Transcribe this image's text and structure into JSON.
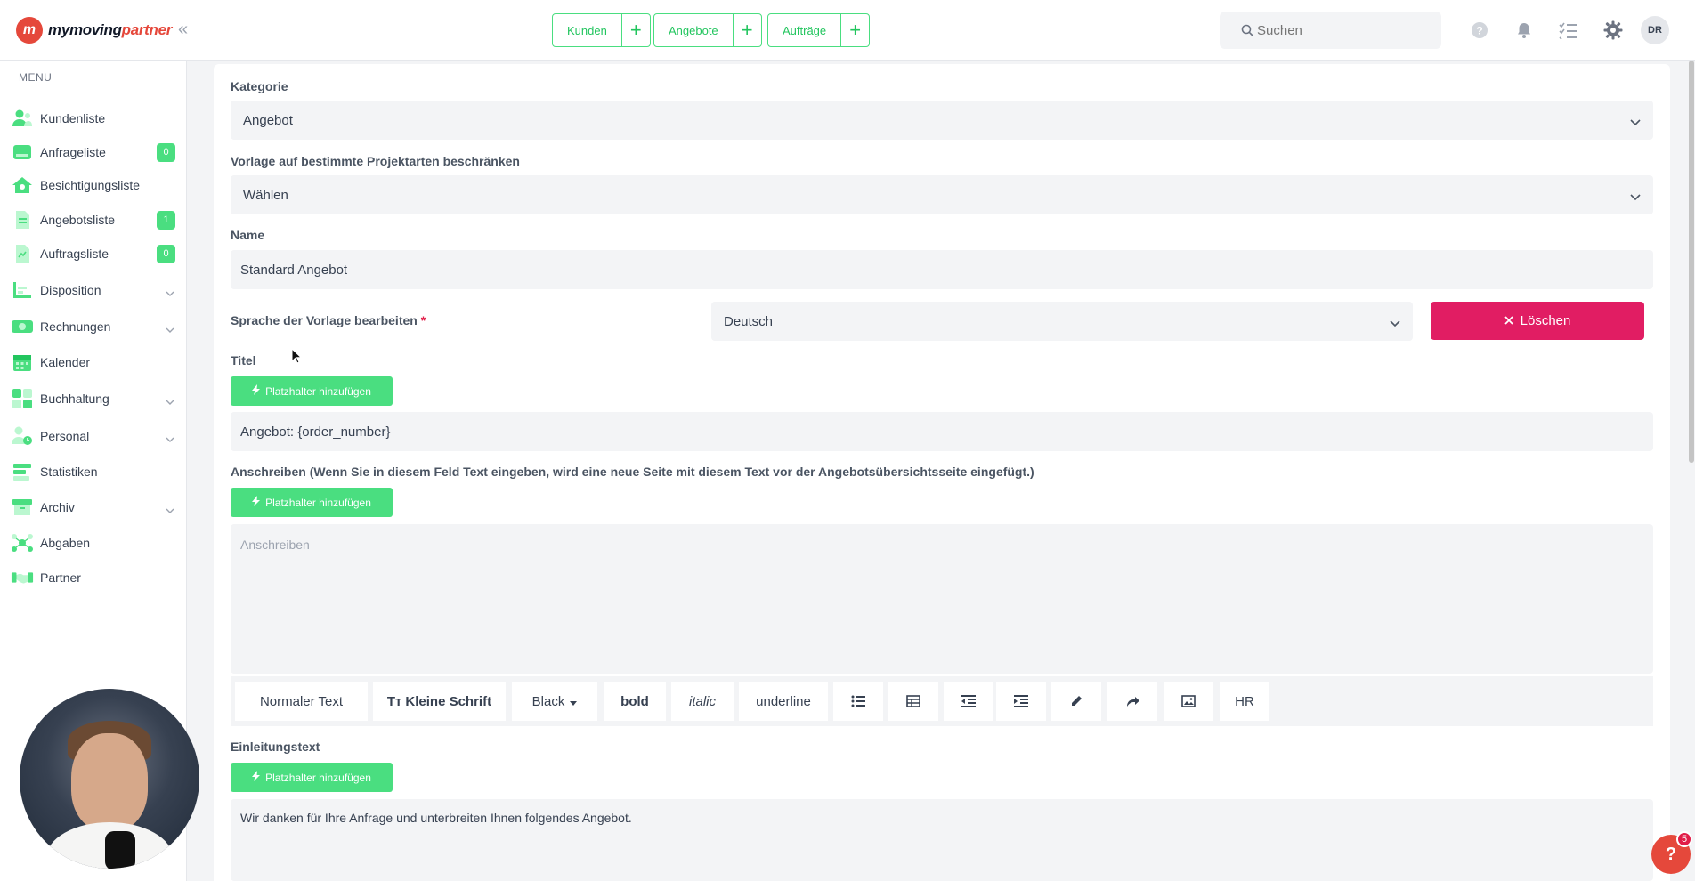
{
  "brand": {
    "name_part1": "mymoving",
    "name_part2": "partner"
  },
  "topbar": {
    "quick_actions": [
      {
        "label": "Kunden",
        "add": "+"
      },
      {
        "label": "Angebote",
        "add": "+"
      },
      {
        "label": "Aufträge",
        "add": "+"
      }
    ],
    "search_placeholder": "Suchen",
    "avatar_initials": "DR",
    "icons": [
      "question-icon",
      "bell-icon",
      "checklist-icon",
      "gear-icon"
    ]
  },
  "sidebar": {
    "menu_label": "MENU",
    "items": [
      {
        "label": "Kundenliste",
        "icon": "customers-icon"
      },
      {
        "label": "Anfrageliste",
        "icon": "inquiry-icon",
        "badge": "0"
      },
      {
        "label": "Besichtigungsliste",
        "icon": "inspection-icon"
      },
      {
        "label": "Angebotsliste",
        "icon": "offer-icon",
        "badge": "1"
      },
      {
        "label": "Auftragsliste",
        "icon": "order-icon",
        "badge": "0"
      },
      {
        "label": "Disposition",
        "icon": "disposition-icon",
        "expandable": true
      },
      {
        "label": "Rechnungen",
        "icon": "invoice-icon",
        "expandable": true
      },
      {
        "label": "Kalender",
        "icon": "calendar-icon"
      },
      {
        "label": "Buchhaltung",
        "icon": "accounting-icon",
        "expandable": true
      },
      {
        "label": "Personal",
        "icon": "personnel-icon",
        "expandable": true
      },
      {
        "label": "Statistiken",
        "icon": "statistics-icon"
      },
      {
        "label": "Archiv",
        "icon": "archive-icon",
        "expandable": true
      },
      {
        "label": "Abgaben",
        "icon": "levies-icon"
      },
      {
        "label": "Partner",
        "icon": "partner-icon"
      }
    ]
  },
  "form": {
    "kategorie": {
      "label": "Kategorie",
      "value": "Angebot"
    },
    "vorlage": {
      "label": "Vorlage auf bestimmte Projektarten beschränken",
      "value": "Wählen"
    },
    "name": {
      "label": "Name",
      "value": "Standard Angebot"
    },
    "sprache": {
      "label": "Sprache der Vorlage bearbeiten",
      "required_mark": "*",
      "value": "Deutsch"
    },
    "delete_button": "Löschen",
    "titel": {
      "label": "Titel",
      "value": "Angebot: {order_number}"
    },
    "anschreiben": {
      "label": "Anschreiben (Wenn Sie in diesem Feld Text eingeben, wird eine neue Seite mit diesem Text vor der Angebotsübersichtsseite eingefügt.)",
      "placeholder": "Anschreiben"
    },
    "einleitung": {
      "label": "Einleitungstext",
      "value": "Wir danken für Ihre Anfrage und unterbreiten Ihnen folgendes Angebot."
    },
    "placeholder_button": "Platzhalter hinzufügen"
  },
  "toolbar": {
    "normal_text": "Normaler Text",
    "small_text": "Kleine Schrift",
    "small_text_icon": "Tт",
    "color": "Black",
    "bold": "bold",
    "italic": "italic",
    "underline": "underline",
    "hr": "HR"
  },
  "help": {
    "label": "?",
    "badge": "5"
  },
  "colors": {
    "accent": "#4ade80",
    "danger": "#e11d63",
    "brand": "#e5483b"
  }
}
